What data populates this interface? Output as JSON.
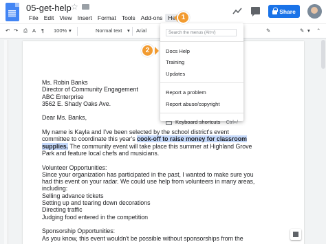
{
  "header": {
    "title": "05-get-help",
    "menu": [
      "File",
      "Edit",
      "View",
      "Insert",
      "Format",
      "Tools",
      "Add-ons",
      "Help"
    ],
    "share_label": "Share"
  },
  "toolbar": {
    "zoom": "100%",
    "style": "Normal text",
    "font": "Arial"
  },
  "help_menu": {
    "search_placeholder": "Search the menus (Alt+/)",
    "items": [
      "Docs Help",
      "Training",
      "Updates",
      "Report a problem",
      "Report abuse/copyright",
      "Keyboard shortcuts"
    ],
    "shortcut": "Ctrl+/"
  },
  "callouts": [
    "1",
    "2"
  ],
  "document": {
    "lines": [
      "Ms. Robin Banks",
      "Director of Community Engagement",
      "ABC Enterprise",
      "3562 E. Shady Oaks Ave.",
      "",
      "Dear Ms. Banks,",
      "",
      "My name is Kayla and I've been selected by the school district's event",
      "committee to coordinate this year's ",
      "cook-off to raise money for classroom",
      "supplies.",
      " The community event will take place this summer at Highland Grove",
      "Park and feature local chefs and musicians.",
      "",
      "Volunteer Opportunities:",
      "Since your organization has participated in the past, I wanted to make sure you",
      "had this event on your radar. We could use help from volunteers in many areas,",
      "including:",
      "Selling advance tickets",
      "Setting up and tearing down decorations",
      "Directing traffic",
      "Judging food entered in the competition",
      "",
      "Sponsorship Opportunities:",
      "As you know, this event wouldn't be possible without sponsorships from the"
    ]
  },
  "colors": {
    "accent": "#1a73e8",
    "callout": "#f29b30",
    "highlight": "#c6dafc"
  }
}
